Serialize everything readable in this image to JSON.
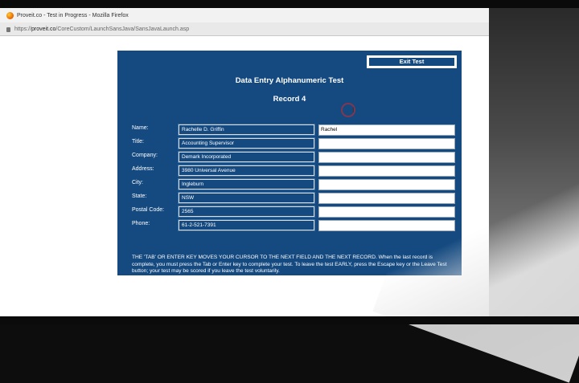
{
  "window": {
    "title": "Proveit.co - Test in Progress - Mozilla Firefox",
    "url_prefix": "https://",
    "url_host": "proveit.co",
    "url_path": "/CoreCustom/LaunchSansJava/SansJavaLaunch.asp"
  },
  "test": {
    "exit_label": "Exit Test",
    "title": "Data Entry Alphanumeric Test",
    "record": "Record 4",
    "rows": [
      {
        "label": "Name:",
        "source": "Rachelle D. Griffin",
        "input": "Rachel"
      },
      {
        "label": "Title:",
        "source": "Accounting Supervisor",
        "input": ""
      },
      {
        "label": "Company:",
        "source": "Demark Incorporated",
        "input": ""
      },
      {
        "label": "Address:",
        "source": "3980 Universal Avenue",
        "input": ""
      },
      {
        "label": "City:",
        "source": "Ingleburn",
        "input": ""
      },
      {
        "label": "State:",
        "source": "NSW",
        "input": ""
      },
      {
        "label": "Postal Code:",
        "source": "2565",
        "input": ""
      },
      {
        "label": "Phone:",
        "source": "61-2-521-7391",
        "input": ""
      }
    ],
    "instructions": "THE 'TAB' OR ENTER KEY MOVES YOUR CURSOR TO THE NEXT FIELD AND THE NEXT RECORD. When the last record is complete, you must press the Tab or Enter key to complete your test. To leave the test EARLY, press the Escape key or the Leave Test button; your test may be scored if you leave the test voluntarily."
  },
  "colors": {
    "panel": "#154a80",
    "page": "#ffffff",
    "text": "#ffffff"
  }
}
